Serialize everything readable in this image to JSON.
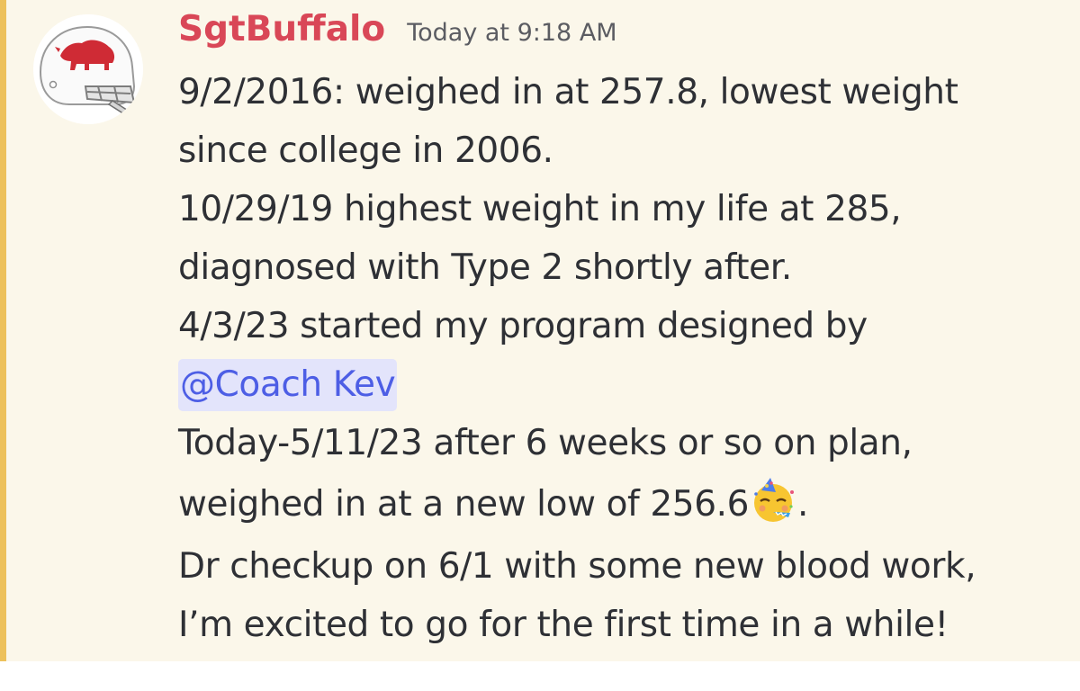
{
  "message": {
    "author": "SgtBuffalo",
    "timestamp": "Today at 9:18 AM",
    "lines": {
      "l1": "9/2/2016: weighed in at 257.8, lowest weight",
      "l2": "since college in 2006.",
      "l3": "10/29/19 highest weight in my life at 285,",
      "l4": "diagnosed with Type 2 shortly after.",
      "l5": "4/3/23 started my program designed by",
      "l7": "Today-5/11/23 after 6 weeks or so on plan,",
      "l8_before": "weighed in at a new low of 256.6",
      "l8_after": ".",
      "l9": "Dr checkup on 6/1 with some new blood work,",
      "l10": "I’m excited to go for the first time in a while!"
    },
    "mention": "@Coach Kev",
    "emoji": "partying-face-emoji"
  },
  "colors": {
    "username": "#d94757",
    "mention_text": "#4d5ee5",
    "mention_bg": "#e3e4fb",
    "highlight_bg": "#fbf7ea",
    "mention_bar": "#edc15b"
  },
  "icons": {
    "avatar": "buffalo-helmet-avatar"
  }
}
